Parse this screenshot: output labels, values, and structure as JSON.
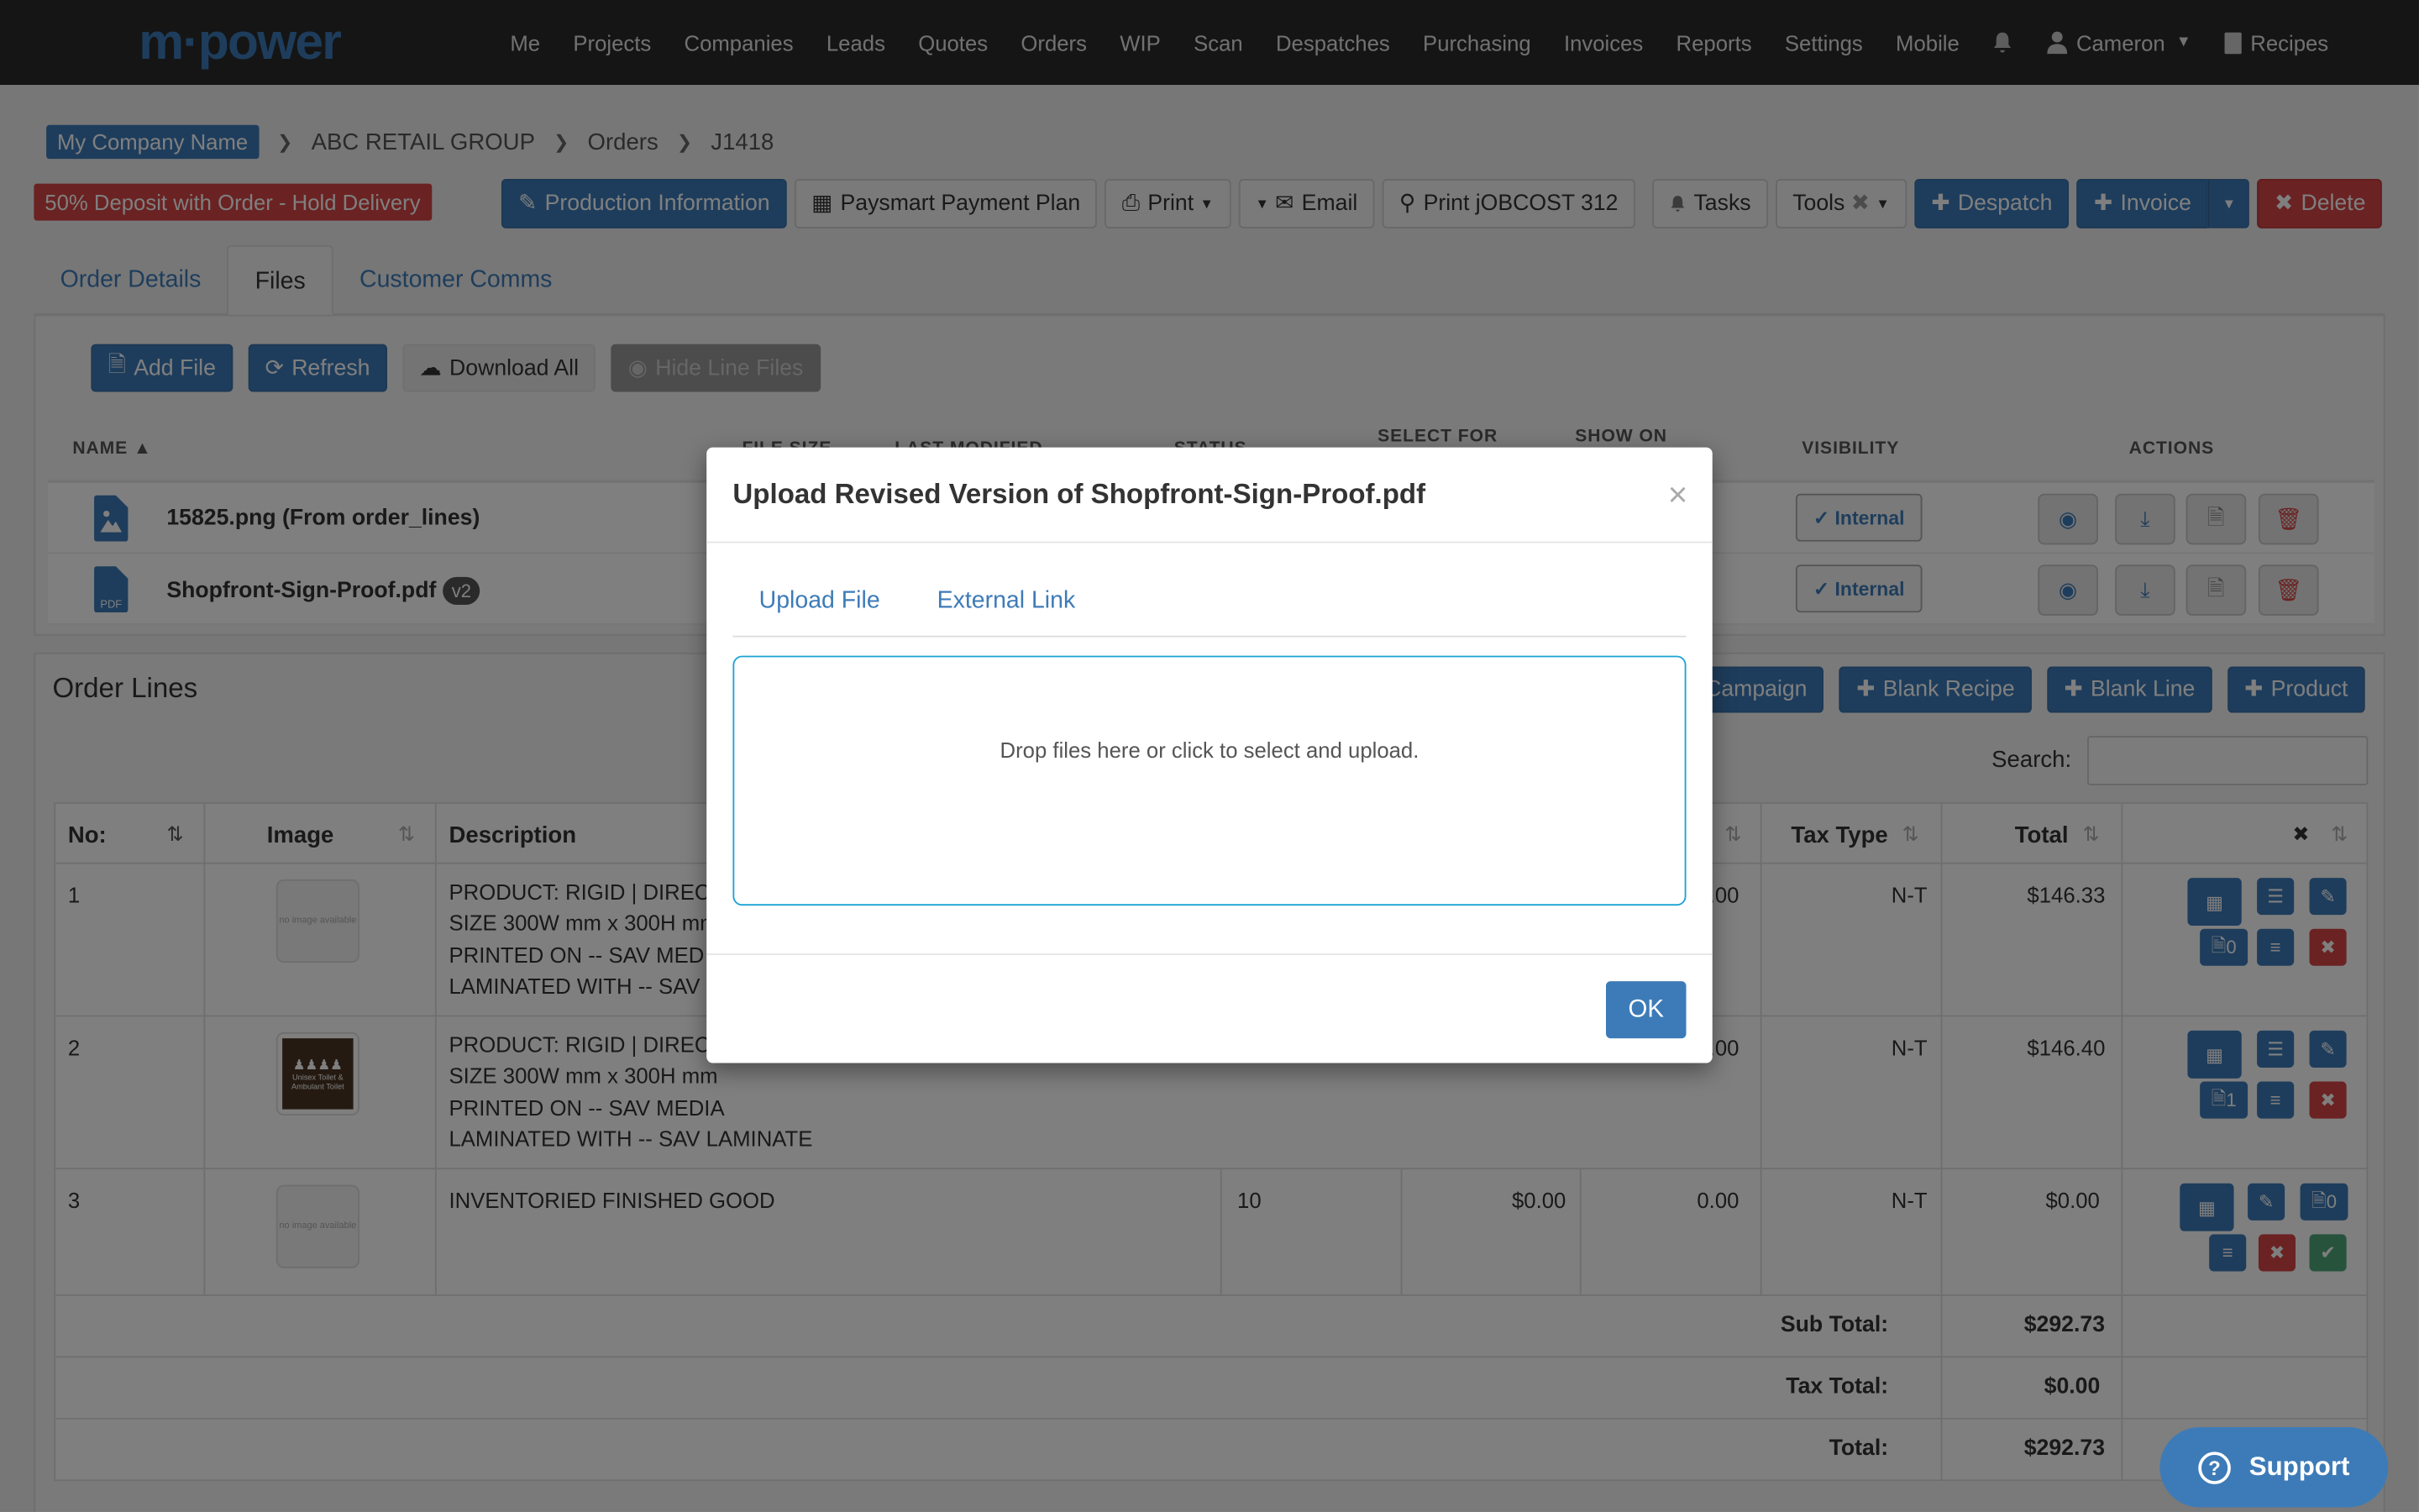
{
  "nav": {
    "logo": "m·power",
    "items": [
      "Me",
      "Projects",
      "Companies",
      "Leads",
      "Quotes",
      "Orders",
      "WIP",
      "Scan",
      "Despatches",
      "Purchasing",
      "Invoices",
      "Reports",
      "Settings",
      "Mobile"
    ],
    "user": "Cameron",
    "recipes": "Recipes"
  },
  "breadcrumb": {
    "company": "My Company Name",
    "client": "ABC RETAIL GROUP",
    "section": "Orders",
    "job": "J1418"
  },
  "alert": "50% Deposit with Order - Hold Delivery",
  "actions": {
    "production": "Production Information",
    "paysmart": "Paysmart Payment Plan",
    "print": "Print",
    "email": "Email",
    "print_jobcost": "Print jOBCOST 312",
    "tasks": "Tasks",
    "tools": "Tools",
    "despatch": "Despatch",
    "invoice": "Invoice",
    "delete": "Delete"
  },
  "tabs": [
    "Order Details",
    "Files",
    "Customer Comms"
  ],
  "files": {
    "toolbar": {
      "add": "Add File",
      "refresh": "Refresh",
      "download_all": "Download All",
      "hide_line": "Hide Line Files"
    },
    "columns": {
      "name": "NAME ▲",
      "file_size": "FILE SIZE",
      "last_modified": "LAST MODIFIED",
      "status": "STATUS",
      "select_for": "SELECT FOR",
      "show_on": "SHOW ON",
      "visibility": "VISIBILITY",
      "actions": "ACTIONS"
    },
    "rows": [
      {
        "name": "15825.png (From order_lines)",
        "badge": "",
        "visibility": "✓ Internal"
      },
      {
        "name": "Shopfront-Sign-Proof.pdf",
        "badge": "v2",
        "visibility": "✓ Internal"
      }
    ]
  },
  "order_lines": {
    "title": "Order Lines",
    "buttons": {
      "campaign": "Campaign",
      "blank_recipe": "Blank Recipe",
      "blank_line": "Blank Line",
      "product": "Product"
    },
    "search_label": "Search:",
    "columns": {
      "no": "No:",
      "image": "Image",
      "description": "Description",
      "tax_type": "Tax Type",
      "total": "Total"
    },
    "no_image_text": "no image available",
    "thumb_text": "Unisex Toilet & Ambulant Toilet",
    "rows": [
      {
        "no": "1",
        "desc1": "PRODUCT: RIGID | DIREC",
        "desc2": "SIZE 300W mm x 300H mm",
        "desc3": "PRINTED ON -- SAV MED",
        "desc4": "LAMINATED WITH -- SAV",
        "col_tax_val": "0.00",
        "tax": "N-T",
        "total": "$146.33",
        "count": "0"
      },
      {
        "no": "2",
        "desc1": "PRODUCT: RIGID | DIREC",
        "desc2": "SIZE 300W mm x 300H mm",
        "desc3": "PRINTED ON -- SAV MEDIA",
        "desc4": "LAMINATED WITH -- SAV LAMINATE",
        "col_tax_val": "0.00",
        "tax": "N-T",
        "total": "$146.40",
        "count": "1"
      },
      {
        "no": "3",
        "desc1": "INVENTORIED FINISHED GOOD",
        "qty": "10",
        "price": "$0.00",
        "col_tax_val": "0.00",
        "tax": "N-T",
        "total": "$0.00",
        "count": "0"
      }
    ],
    "totals": [
      {
        "label": "Sub Total:",
        "value": "$292.73"
      },
      {
        "label": "Tax Total:",
        "value": "$0.00"
      },
      {
        "label": "Total:",
        "value": "$292.73"
      }
    ]
  },
  "support": "Support",
  "modal": {
    "title": "Upload Revised Version of Shopfront-Sign-Proof.pdf",
    "tabs": [
      "Upload File",
      "External Link"
    ],
    "dropzone": "Drop files here or click to select and upload.",
    "ok": "OK"
  },
  "colors": {
    "brand_blue": "#3d7bb8",
    "danger": "#d64545",
    "nav_bg": "#2b2b2b"
  }
}
